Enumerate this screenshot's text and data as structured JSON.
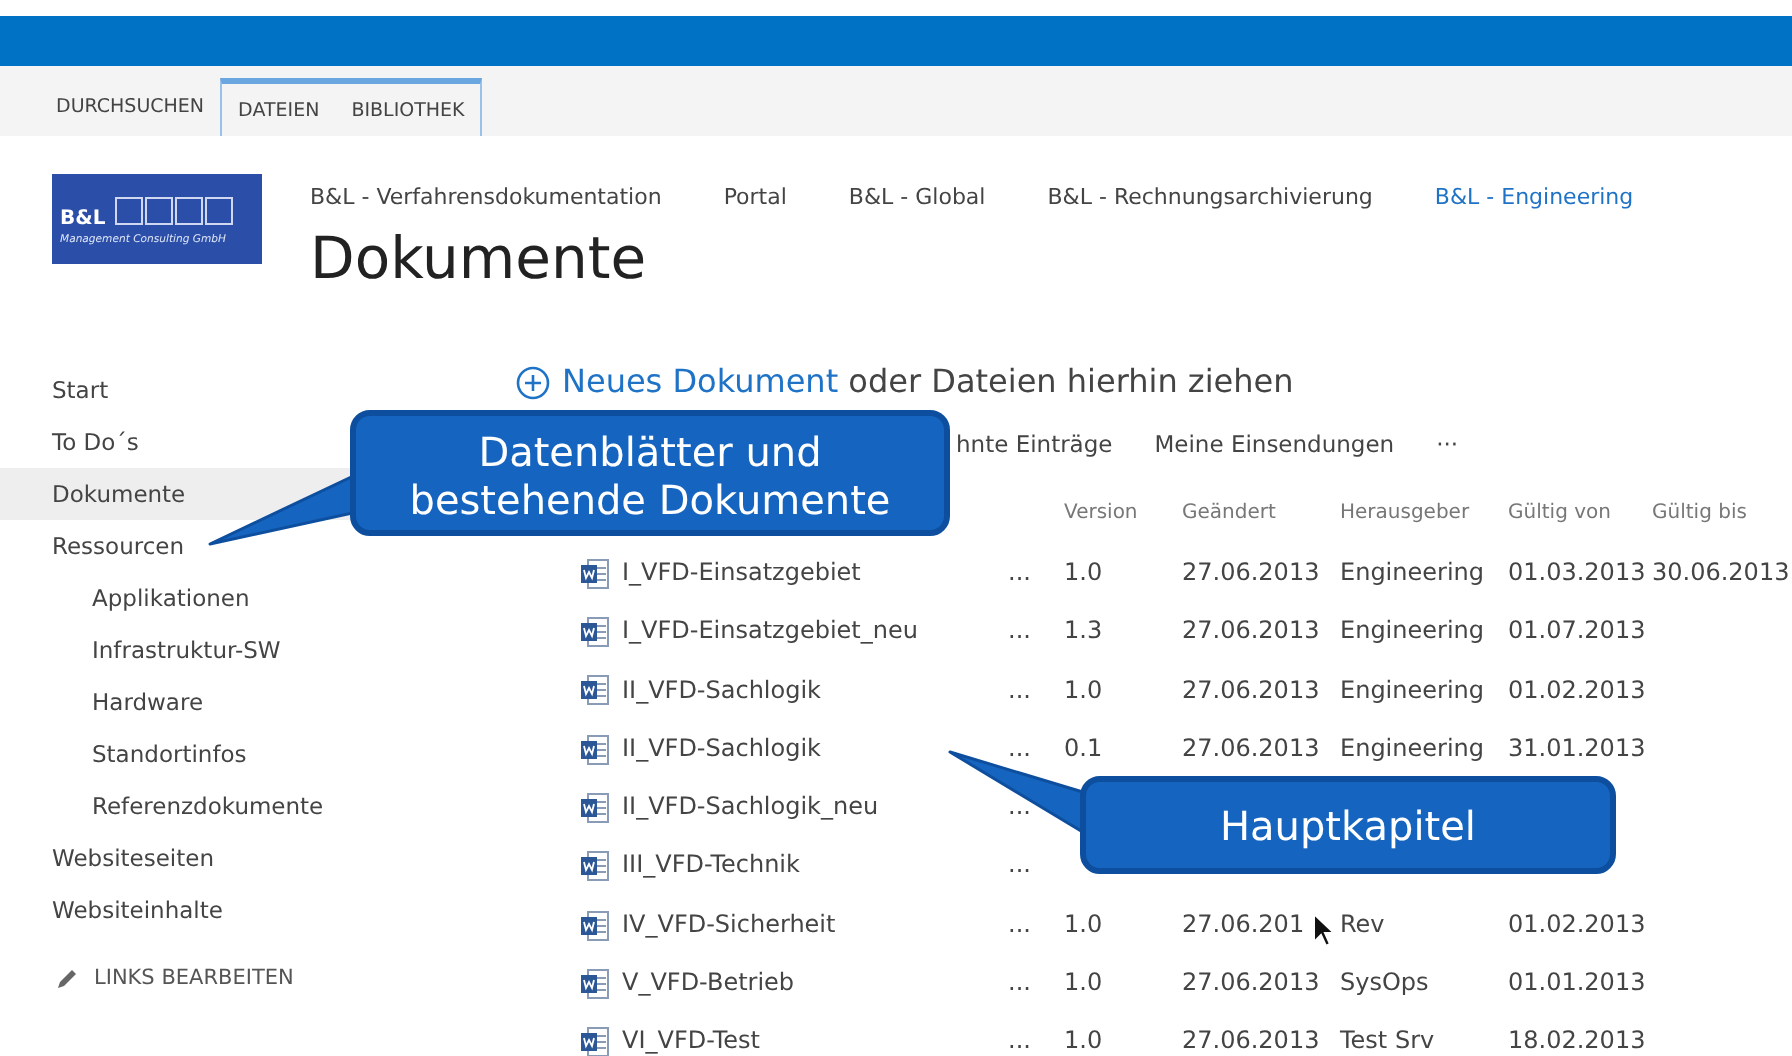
{
  "ribbon_tabs": [
    {
      "label": "DURCHSUCHEN",
      "contextual": false
    },
    {
      "label": "DATEIEN",
      "contextual": true
    },
    {
      "label": "BIBLIOTHEK",
      "contextual": true
    }
  ],
  "logo": {
    "name": "B&L",
    "subtitle": "Management Consulting GmbH"
  },
  "top_nav": [
    {
      "label": "B&L - Verfahrensdokumentation",
      "selected": false
    },
    {
      "label": "Portal",
      "selected": false
    },
    {
      "label": "B&L - Global",
      "selected": false
    },
    {
      "label": "B&L - Rechnungsarchivierung",
      "selected": false
    },
    {
      "label": "B&L - Engineering",
      "selected": true
    }
  ],
  "page_title": "Dokumente",
  "sidebar": {
    "items": [
      {
        "label": "Start",
        "selected": false
      },
      {
        "label": "To Do´s",
        "selected": false
      },
      {
        "label": "Dokumente",
        "selected": true
      },
      {
        "label": "Ressourcen",
        "selected": false,
        "children": [
          {
            "label": "Applikationen",
            "selected": false
          },
          {
            "label": "Infrastruktur-SW",
            "selected": false
          },
          {
            "label": "Hardware",
            "selected": false
          },
          {
            "label": "Standortinfos",
            "selected": false
          },
          {
            "label": "Referenzdokumente",
            "selected": false
          }
        ]
      },
      {
        "label": "Websiteseiten",
        "selected": false
      },
      {
        "label": "Websiteinhalte",
        "selected": false
      }
    ],
    "edit_links": "LINKS BEARBEITEN"
  },
  "new_document": {
    "link": "Neues Dokument",
    "rest": "oder Dateien hierhin ziehen"
  },
  "views": [
    "hnte Einträge",
    "Meine Einsendungen",
    "···"
  ],
  "table": {
    "columns": [
      "",
      "",
      "",
      "Version",
      "Geändert",
      "Herausgeber",
      "Gültig von",
      "Gültig bis"
    ],
    "rows": [
      {
        "name": "I_VFD-Einsatzgebiet",
        "menu": "...",
        "version": "1.0",
        "changed": "27.06.2013",
        "publisher": "Engineering",
        "valid_from": "01.03.2013",
        "valid_to": "30.06.2013"
      },
      {
        "name": "I_VFD-Einsatzgebiet_neu",
        "menu": "...",
        "version": "1.3",
        "changed": "27.06.2013",
        "publisher": "Engineering",
        "valid_from": "01.07.2013"
      },
      {
        "name": "II_VFD-Sachlogik",
        "menu": "...",
        "version": "1.0",
        "changed": "27.06.2013",
        "publisher": "Engineering",
        "valid_from": "01.02.2013"
      },
      {
        "name": "II_VFD-Sachlogik",
        "menu": "...",
        "version": "0.1",
        "changed": "27.06.2013",
        "publisher": "Engineering",
        "valid_from": "31.01.2013"
      },
      {
        "name": "II_VFD-Sachlogik_neu",
        "menu": "..."
      },
      {
        "name": "III_VFD-Technik",
        "menu": "..."
      },
      {
        "name": "IV_VFD-Sicherheit",
        "menu": "...",
        "version": "1.0",
        "changed": "27.06.201",
        "publisher": "Rev",
        "valid_from": "01.02.2013"
      },
      {
        "name": "V_VFD-Betrieb",
        "menu": "...",
        "version": "1.0",
        "changed": "27.06.2013",
        "publisher": "SysOps",
        "valid_from": "01.01.2013"
      },
      {
        "name": "VI_VFD-Test",
        "menu": "...",
        "version": "1.0",
        "changed": "27.06.2013",
        "publisher": "Test Srv",
        "valid_from": "18.02.2013"
      }
    ]
  },
  "callouts": [
    "Datenblätter und bestehende Dokumente",
    "Hauptkapitel"
  ]
}
